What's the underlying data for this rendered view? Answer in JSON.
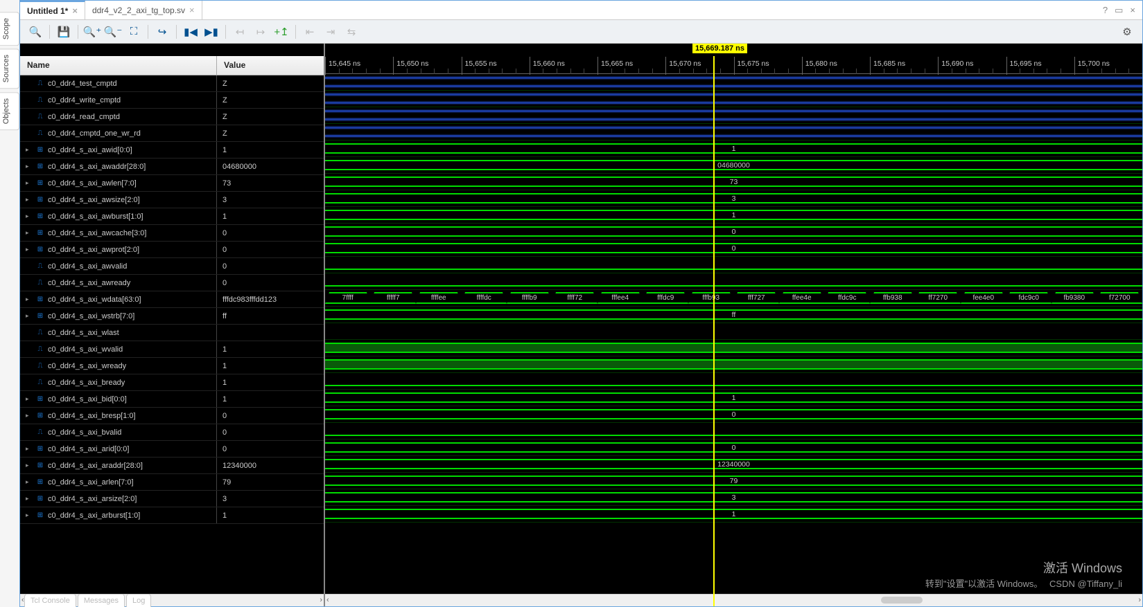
{
  "side_tabs": [
    "Scope",
    "Sources",
    "Objects"
  ],
  "tabs": [
    {
      "label": "Untitled 1*",
      "active": true
    },
    {
      "label": "ddr4_v2_2_axi_tg_top.sv",
      "active": false
    }
  ],
  "toolbar_icons": [
    "search-icon",
    "save-icon",
    "zoom-in-icon",
    "zoom-out-icon",
    "zoom-fit-icon",
    "goto-icon",
    "first-icon",
    "last-icon",
    "prev-edge-icon",
    "next-edge-icon",
    "add-marker-icon",
    "prev-tr-icon",
    "next-tr-icon",
    "swap-icon"
  ],
  "gear_icon": "⚙",
  "headers": {
    "name": "Name",
    "value": "Value"
  },
  "marker": {
    "label": "15,669.187 ns",
    "pos_pct": 47.5
  },
  "ruler": [
    "15,645 ns",
    "15,650 ns",
    "15,655 ns",
    "15,660 ns",
    "15,665 ns",
    "15,670 ns",
    "15,675 ns",
    "15,680 ns",
    "15,685 ns",
    "15,690 ns",
    "15,695 ns",
    "15,700 ns"
  ],
  "signals": [
    {
      "name": "c0_ddr4_test_cmptd",
      "value": "Z",
      "exp": false,
      "ico": "s",
      "wave": "blue"
    },
    {
      "name": "c0_ddr4_write_cmptd",
      "value": "Z",
      "exp": false,
      "ico": "s",
      "wave": "blue"
    },
    {
      "name": "c0_ddr4_read_cmptd",
      "value": "Z",
      "exp": false,
      "ico": "s",
      "wave": "blue"
    },
    {
      "name": "c0_ddr4_cmptd_one_wr_rd",
      "value": "Z",
      "exp": false,
      "ico": "s",
      "wave": "blue"
    },
    {
      "name": "c0_ddr4_s_axi_awid[0:0]",
      "value": "1",
      "exp": true,
      "ico": "b",
      "wave": "bus",
      "center": "1"
    },
    {
      "name": "c0_ddr4_s_axi_awaddr[28:0]",
      "value": "04680000",
      "exp": true,
      "ico": "b",
      "wave": "bus",
      "center": "04680000"
    },
    {
      "name": "c0_ddr4_s_axi_awlen[7:0]",
      "value": "73",
      "exp": true,
      "ico": "b",
      "wave": "bus",
      "center": "73"
    },
    {
      "name": "c0_ddr4_s_axi_awsize[2:0]",
      "value": "3",
      "exp": true,
      "ico": "b",
      "wave": "bus",
      "center": "3"
    },
    {
      "name": "c0_ddr4_s_axi_awburst[1:0]",
      "value": "1",
      "exp": true,
      "ico": "b",
      "wave": "bus",
      "center": "1"
    },
    {
      "name": "c0_ddr4_s_axi_awcache[3:0]",
      "value": "0",
      "exp": true,
      "ico": "b",
      "wave": "bus",
      "center": "0"
    },
    {
      "name": "c0_ddr4_s_axi_awprot[2:0]",
      "value": "0",
      "exp": true,
      "ico": "b",
      "wave": "bus",
      "center": "0"
    },
    {
      "name": "c0_ddr4_s_axi_awvalid",
      "value": "0",
      "exp": false,
      "ico": "s",
      "wave": "low"
    },
    {
      "name": "c0_ddr4_s_axi_awready",
      "value": "0",
      "exp": false,
      "ico": "s",
      "wave": "low"
    },
    {
      "name": "c0_ddr4_s_axi_wdata[63:0]",
      "value": "fffdc983fffdd123",
      "exp": true,
      "ico": "b",
      "wave": "segs",
      "segs": [
        "7ffff",
        "fffff7",
        "ffffee",
        "ffffdc",
        "ffffb9",
        "ffff72",
        "fffee4",
        "fffdc9",
        "fffb93",
        "fff727",
        "ffee4e",
        "ffdc9c",
        "ffb938",
        "ff7270",
        "fee4e0",
        "fdc9c0",
        "fb9380",
        "f72700"
      ]
    },
    {
      "name": "c0_ddr4_s_axi_wstrb[7:0]",
      "value": "ff",
      "exp": true,
      "ico": "b",
      "wave": "bus",
      "center": "ff"
    },
    {
      "name": "c0_ddr4_s_axi_wlast",
      "value": "",
      "exp": false,
      "ico": "s",
      "wave": "empty"
    },
    {
      "name": "c0_ddr4_s_axi_wvalid",
      "value": "1",
      "exp": false,
      "ico": "s",
      "wave": "high"
    },
    {
      "name": "c0_ddr4_s_axi_wready",
      "value": "1",
      "exp": false,
      "ico": "s",
      "wave": "high"
    },
    {
      "name": "c0_ddr4_s_axi_bready",
      "value": "1",
      "exp": false,
      "ico": "s",
      "wave": "low"
    },
    {
      "name": "c0_ddr4_s_axi_bid[0:0]",
      "value": "1",
      "exp": true,
      "ico": "b",
      "wave": "bus",
      "center": "1"
    },
    {
      "name": "c0_ddr4_s_axi_bresp[1:0]",
      "value": "0",
      "exp": true,
      "ico": "b",
      "wave": "bus",
      "center": "0"
    },
    {
      "name": "c0_ddr4_s_axi_bvalid",
      "value": "0",
      "exp": false,
      "ico": "s",
      "wave": "low"
    },
    {
      "name": "c0_ddr4_s_axi_arid[0:0]",
      "value": "0",
      "exp": true,
      "ico": "b",
      "wave": "bus",
      "center": "0"
    },
    {
      "name": "c0_ddr4_s_axi_araddr[28:0]",
      "value": "12340000",
      "exp": true,
      "ico": "b",
      "wave": "bus",
      "center": "12340000"
    },
    {
      "name": "c0_ddr4_s_axi_arlen[7:0]",
      "value": "79",
      "exp": true,
      "ico": "b",
      "wave": "bus",
      "center": "79"
    },
    {
      "name": "c0_ddr4_s_axi_arsize[2:0]",
      "value": "3",
      "exp": true,
      "ico": "b",
      "wave": "bus",
      "center": "3"
    },
    {
      "name": "c0_ddr4_s_axi_arburst[1:0]",
      "value": "1",
      "exp": true,
      "ico": "b",
      "wave": "bus",
      "center": "1"
    }
  ],
  "watermark": {
    "line1": "激活 Windows",
    "line2": "转到\"设置\"以激活 Windows。",
    "credit": "CSDN @Tiffany_li"
  },
  "bottom_tabs": [
    "Tcl Console",
    "Messages",
    "Log"
  ]
}
